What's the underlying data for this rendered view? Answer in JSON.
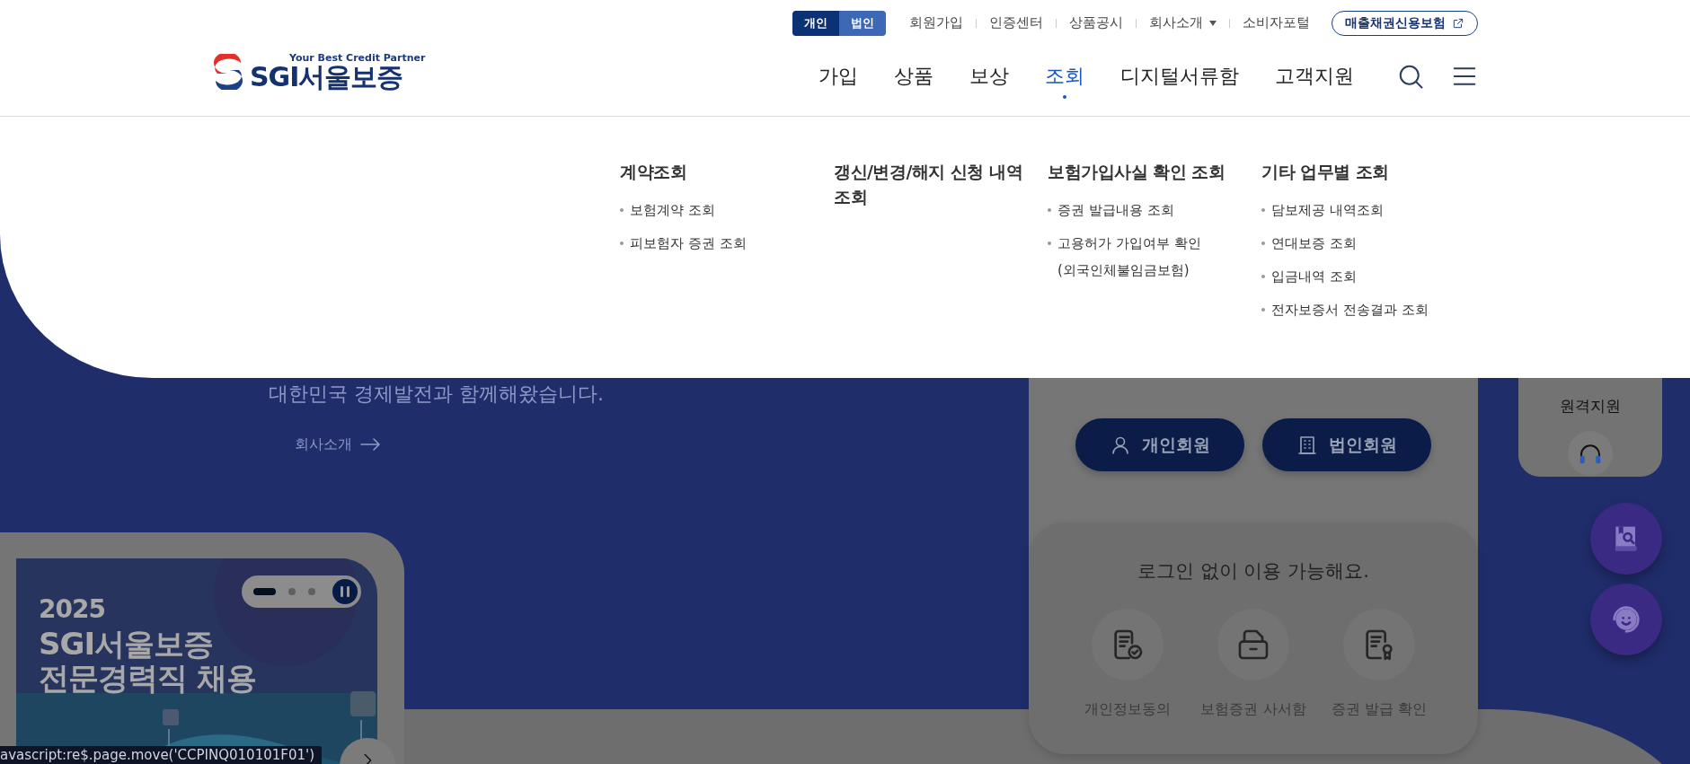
{
  "top_links": {
    "account_toggle": [
      {
        "label": "개인",
        "selected": true
      },
      {
        "label": "법인",
        "selected": false
      }
    ],
    "links": [
      {
        "label": "회원가입",
        "dropdown": false
      },
      {
        "label": "인증센터",
        "dropdown": false
      },
      {
        "label": "상품공시",
        "dropdown": false
      },
      {
        "label": "회사소개",
        "dropdown": true
      },
      {
        "label": "소비자포털",
        "dropdown": false
      }
    ],
    "external_button": "매출채권신용보험"
  },
  "logo": {
    "tagline": "Your Best Credit Partner",
    "name": "SGI서울보증"
  },
  "nav": [
    {
      "label": "가입",
      "selected": false
    },
    {
      "label": "상품",
      "selected": false
    },
    {
      "label": "보상",
      "selected": false
    },
    {
      "label": "조회",
      "selected": true
    },
    {
      "label": "디지털서류함",
      "selected": false
    },
    {
      "label": "고객지원",
      "selected": false
    }
  ],
  "mega_menu": {
    "columns": [
      {
        "heading": "계약조회",
        "items": [
          "보험계약 조회",
          "피보험자 증권 조회"
        ]
      },
      {
        "heading": "갱신/변경/해지 신청 내역 조회"
      },
      {
        "heading": "보험가입사실 확인 조회",
        "items": [
          "증권 발급내용 조회",
          "고용허가 가입여부 확인 (외국인체불임금보험)"
        ]
      },
      {
        "heading": "기타 업무별 조회",
        "items": [
          "담보제공 내역조회",
          "연대보증 조회",
          "입금내역 조회",
          "전자보증서 전송결과 조회"
        ]
      }
    ]
  },
  "hero": {
    "subtitle": "대한민국 경제발전과 함께해왔습니다.",
    "link": "회사소개"
  },
  "banner": {
    "title_lines": [
      "2025",
      "SGI서울보증",
      "전문경력직 채용"
    ],
    "slides": [
      {
        "selected": true
      },
      {
        "selected": false
      },
      {
        "selected": false
      }
    ]
  },
  "login_panel": {
    "buttons": [
      {
        "label": "개인회원",
        "kind": "person"
      },
      {
        "label": "법인회원",
        "kind": "company"
      }
    ],
    "guest_title": "로그인 없이 이용 가능해요.",
    "guest_services": [
      {
        "label": "개인정보동의",
        "kind": "consent"
      },
      {
        "label": "보험증권 사서함",
        "kind": "mailbox"
      },
      {
        "label": "증권 발급 확인",
        "kind": "certificate"
      }
    ]
  },
  "quick_menu": {
    "remote_support": "원격지원"
  },
  "status_bar": "avascript:re$.page.move('CCPINQ010101F01')"
}
